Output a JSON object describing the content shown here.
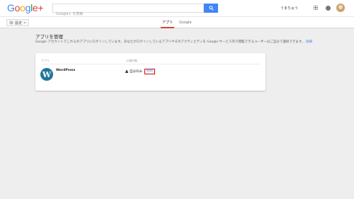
{
  "header": {
    "logo": {
      "g1": "G",
      "o1": "o",
      "o2": "o",
      "g2": "g",
      "l": "l",
      "e": "e",
      "plus": "+"
    },
    "search_placeholder": "Google+ を検索",
    "user_name": "うまちゅう"
  },
  "subbar": {
    "settings_label": "設定",
    "tabs": [
      {
        "label": "アプリ",
        "active": true
      },
      {
        "label": "Google",
        "active": false
      }
    ]
  },
  "main": {
    "title": "アプリを管理",
    "description": "Google アカウントでこれらのアプリにログインしています。あなたがログインしているアプリやそのアクティビティを Google サービス内で閲覧できるユーザーはご自分で選択できます。",
    "details_link": "詳細"
  },
  "card": {
    "columns": {
      "app": "アプリ",
      "audience": "公開対象"
    },
    "apps": [
      {
        "name": "WordPress",
        "audience": "自分のみ",
        "delete_label": "削除"
      }
    ]
  },
  "colors": {
    "accent_blue": "#4285f4",
    "active_tab_underline": "#db4437",
    "highlight_box": "#d50000",
    "wordpress_blue": "#21759b",
    "background": "#eeeeee"
  },
  "icons": [
    "search-icon",
    "apps-grid-icon",
    "notifications-icon",
    "gear-icon",
    "chevron-down-icon",
    "lock-icon",
    "wordpress-logo-icon"
  ]
}
